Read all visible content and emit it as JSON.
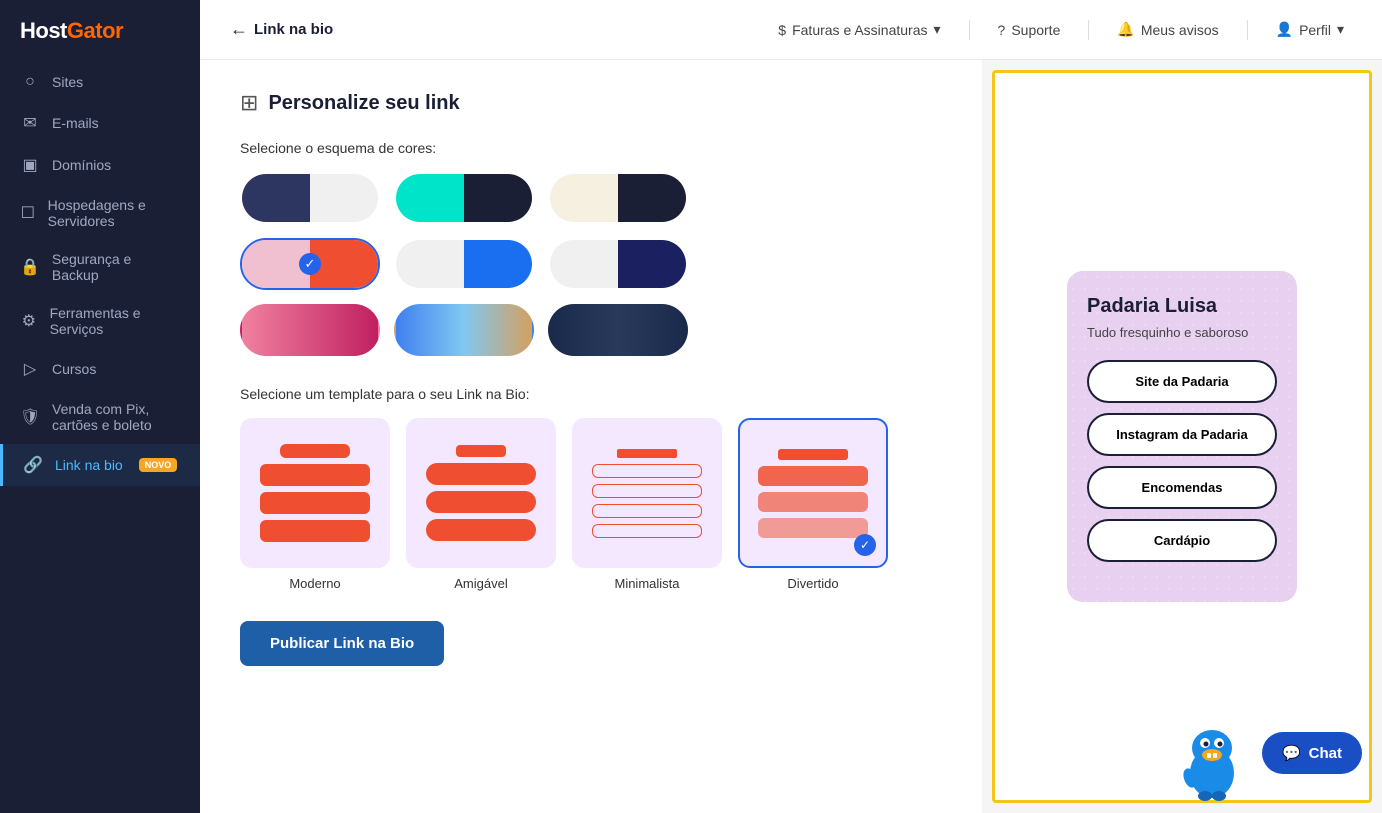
{
  "sidebar": {
    "logo": "HostGator",
    "items": [
      {
        "id": "sites",
        "label": "Sites",
        "icon": "⊕"
      },
      {
        "id": "emails",
        "label": "E-mails",
        "icon": "✉"
      },
      {
        "id": "dominios",
        "label": "Domínios",
        "icon": "⬛"
      },
      {
        "id": "hospedagens",
        "label": "Hospedagens e Servidores",
        "icon": "⬜"
      },
      {
        "id": "seguranca",
        "label": "Segurança e Backup",
        "icon": "🔒"
      },
      {
        "id": "ferramentas",
        "label": "Ferramentas e Serviços",
        "icon": "⚙"
      },
      {
        "id": "cursos",
        "label": "Cursos",
        "icon": "▷"
      },
      {
        "id": "venda",
        "label": "Venda com Pix, cartões e boleto",
        "icon": "🛡"
      },
      {
        "id": "linkbio",
        "label": "Link na bio",
        "icon": "🔗",
        "active": true,
        "badge": "NOVO"
      }
    ]
  },
  "topbar": {
    "back_label": "Link na bio",
    "faturas_label": "Faturas e Assinaturas",
    "suporte_label": "Suporte",
    "avisos_label": "Meus avisos",
    "perfil_label": "Perfil"
  },
  "page": {
    "icon": "⊞",
    "title": "Personalize seu link",
    "color_section_label": "Selecione o esquema de cores:",
    "template_section_label": "Selecione um template para o seu Link na Bio:",
    "publish_btn": "Publicar Link na Bio"
  },
  "color_swatches": [
    {
      "id": "dark-teal",
      "left": "#2d3561",
      "right": "#f0f0f0",
      "selected": false
    },
    {
      "id": "cyan-dark",
      "left": "#00e5c9",
      "right": "#1a1f36",
      "selected": false
    },
    {
      "id": "cream-dark",
      "left": "#f5f0e0",
      "right": "#1a1f36",
      "selected": false
    },
    {
      "id": "pink-orange",
      "left": "#f0c0d0",
      "right": "#f04e30",
      "selected": true
    },
    {
      "id": "white-blue",
      "left": "#f0f0f0",
      "right": "#1a6ef0",
      "selected": false
    },
    {
      "id": "white-navy",
      "left": "#f0f0f0",
      "right": "#1a2060",
      "selected": false
    },
    {
      "id": "pink-red",
      "left": "#f080a0",
      "right": "#c02060",
      "selected": false
    },
    {
      "id": "gradient-blue",
      "left": "#4080f0",
      "right": "#80c0f0",
      "selected": false
    },
    {
      "id": "dark-gradient",
      "left": "#1a2a4a",
      "right": "#2a3a5a",
      "selected": false
    }
  ],
  "templates": [
    {
      "id": "moderno",
      "label": "Moderno",
      "selected": false
    },
    {
      "id": "amigavel",
      "label": "Amigável",
      "selected": false
    },
    {
      "id": "minimalista",
      "label": "Minimalista",
      "selected": false
    },
    {
      "id": "divertido",
      "label": "Divertido",
      "selected": true
    }
  ],
  "preview": {
    "name": "Padaria Luisa",
    "description": "Tudo fresquinho e saboroso",
    "buttons": [
      "Site da Padaria",
      "Instagram da Padaria",
      "Encomendas",
      "Cardápio"
    ]
  },
  "chat": {
    "label": "Chat"
  }
}
